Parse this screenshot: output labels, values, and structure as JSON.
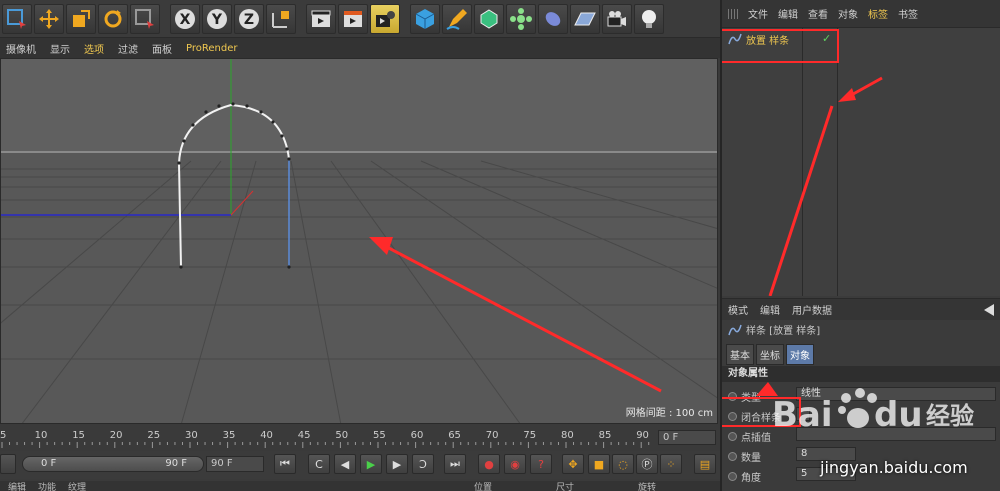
{
  "viewport_menu": {
    "items": [
      "摄像机",
      "显示",
      "选项",
      "过滤",
      "面板",
      "ProRender"
    ],
    "highlight_index": 2
  },
  "viewport": {
    "grid_info": "网格间距 : 100 cm"
  },
  "object_manager": {
    "menu": [
      "文件",
      "编辑",
      "查看",
      "对象",
      "标签",
      "书签"
    ],
    "highlight_index": 4,
    "object_name": "放置 样条"
  },
  "attribute_manager": {
    "menu": [
      "模式",
      "编辑",
      "用户数据"
    ],
    "title": "样条 [放置 样条]",
    "tabs": [
      "基本",
      "坐标",
      "对象"
    ],
    "active_tab_index": 2,
    "section": "对象属性",
    "props": [
      {
        "label": "类型",
        "value": "线性"
      },
      {
        "label": "闭合样条",
        "value": ""
      },
      {
        "label": "点插值",
        "value": ""
      },
      {
        "label": "数量",
        "value": "8"
      },
      {
        "label": "角度",
        "value": "5"
      }
    ]
  },
  "timeline": {
    "ticks": [
      "5",
      "10",
      "15",
      "20",
      "25",
      "30",
      "35",
      "40",
      "45",
      "50",
      "55",
      "60",
      "65",
      "70",
      "75",
      "80",
      "85",
      "90"
    ],
    "leading_tick": "5",
    "current_frame": "0 F",
    "range_start": "0 F",
    "range_end": "90 F",
    "end_frame": "90 F"
  },
  "bottom_bar": [
    "编辑",
    "功能",
    "纹理",
    "位置",
    "尺寸",
    "旋转"
  ],
  "watermark": {
    "logo": "Bai du 经验",
    "url": "jingyan.baidu.com"
  },
  "colors": {
    "accent": "#f0c850",
    "annotation": "#ff2a2a",
    "x_axis": "#2828c8",
    "y_axis": "#2aa82a"
  }
}
